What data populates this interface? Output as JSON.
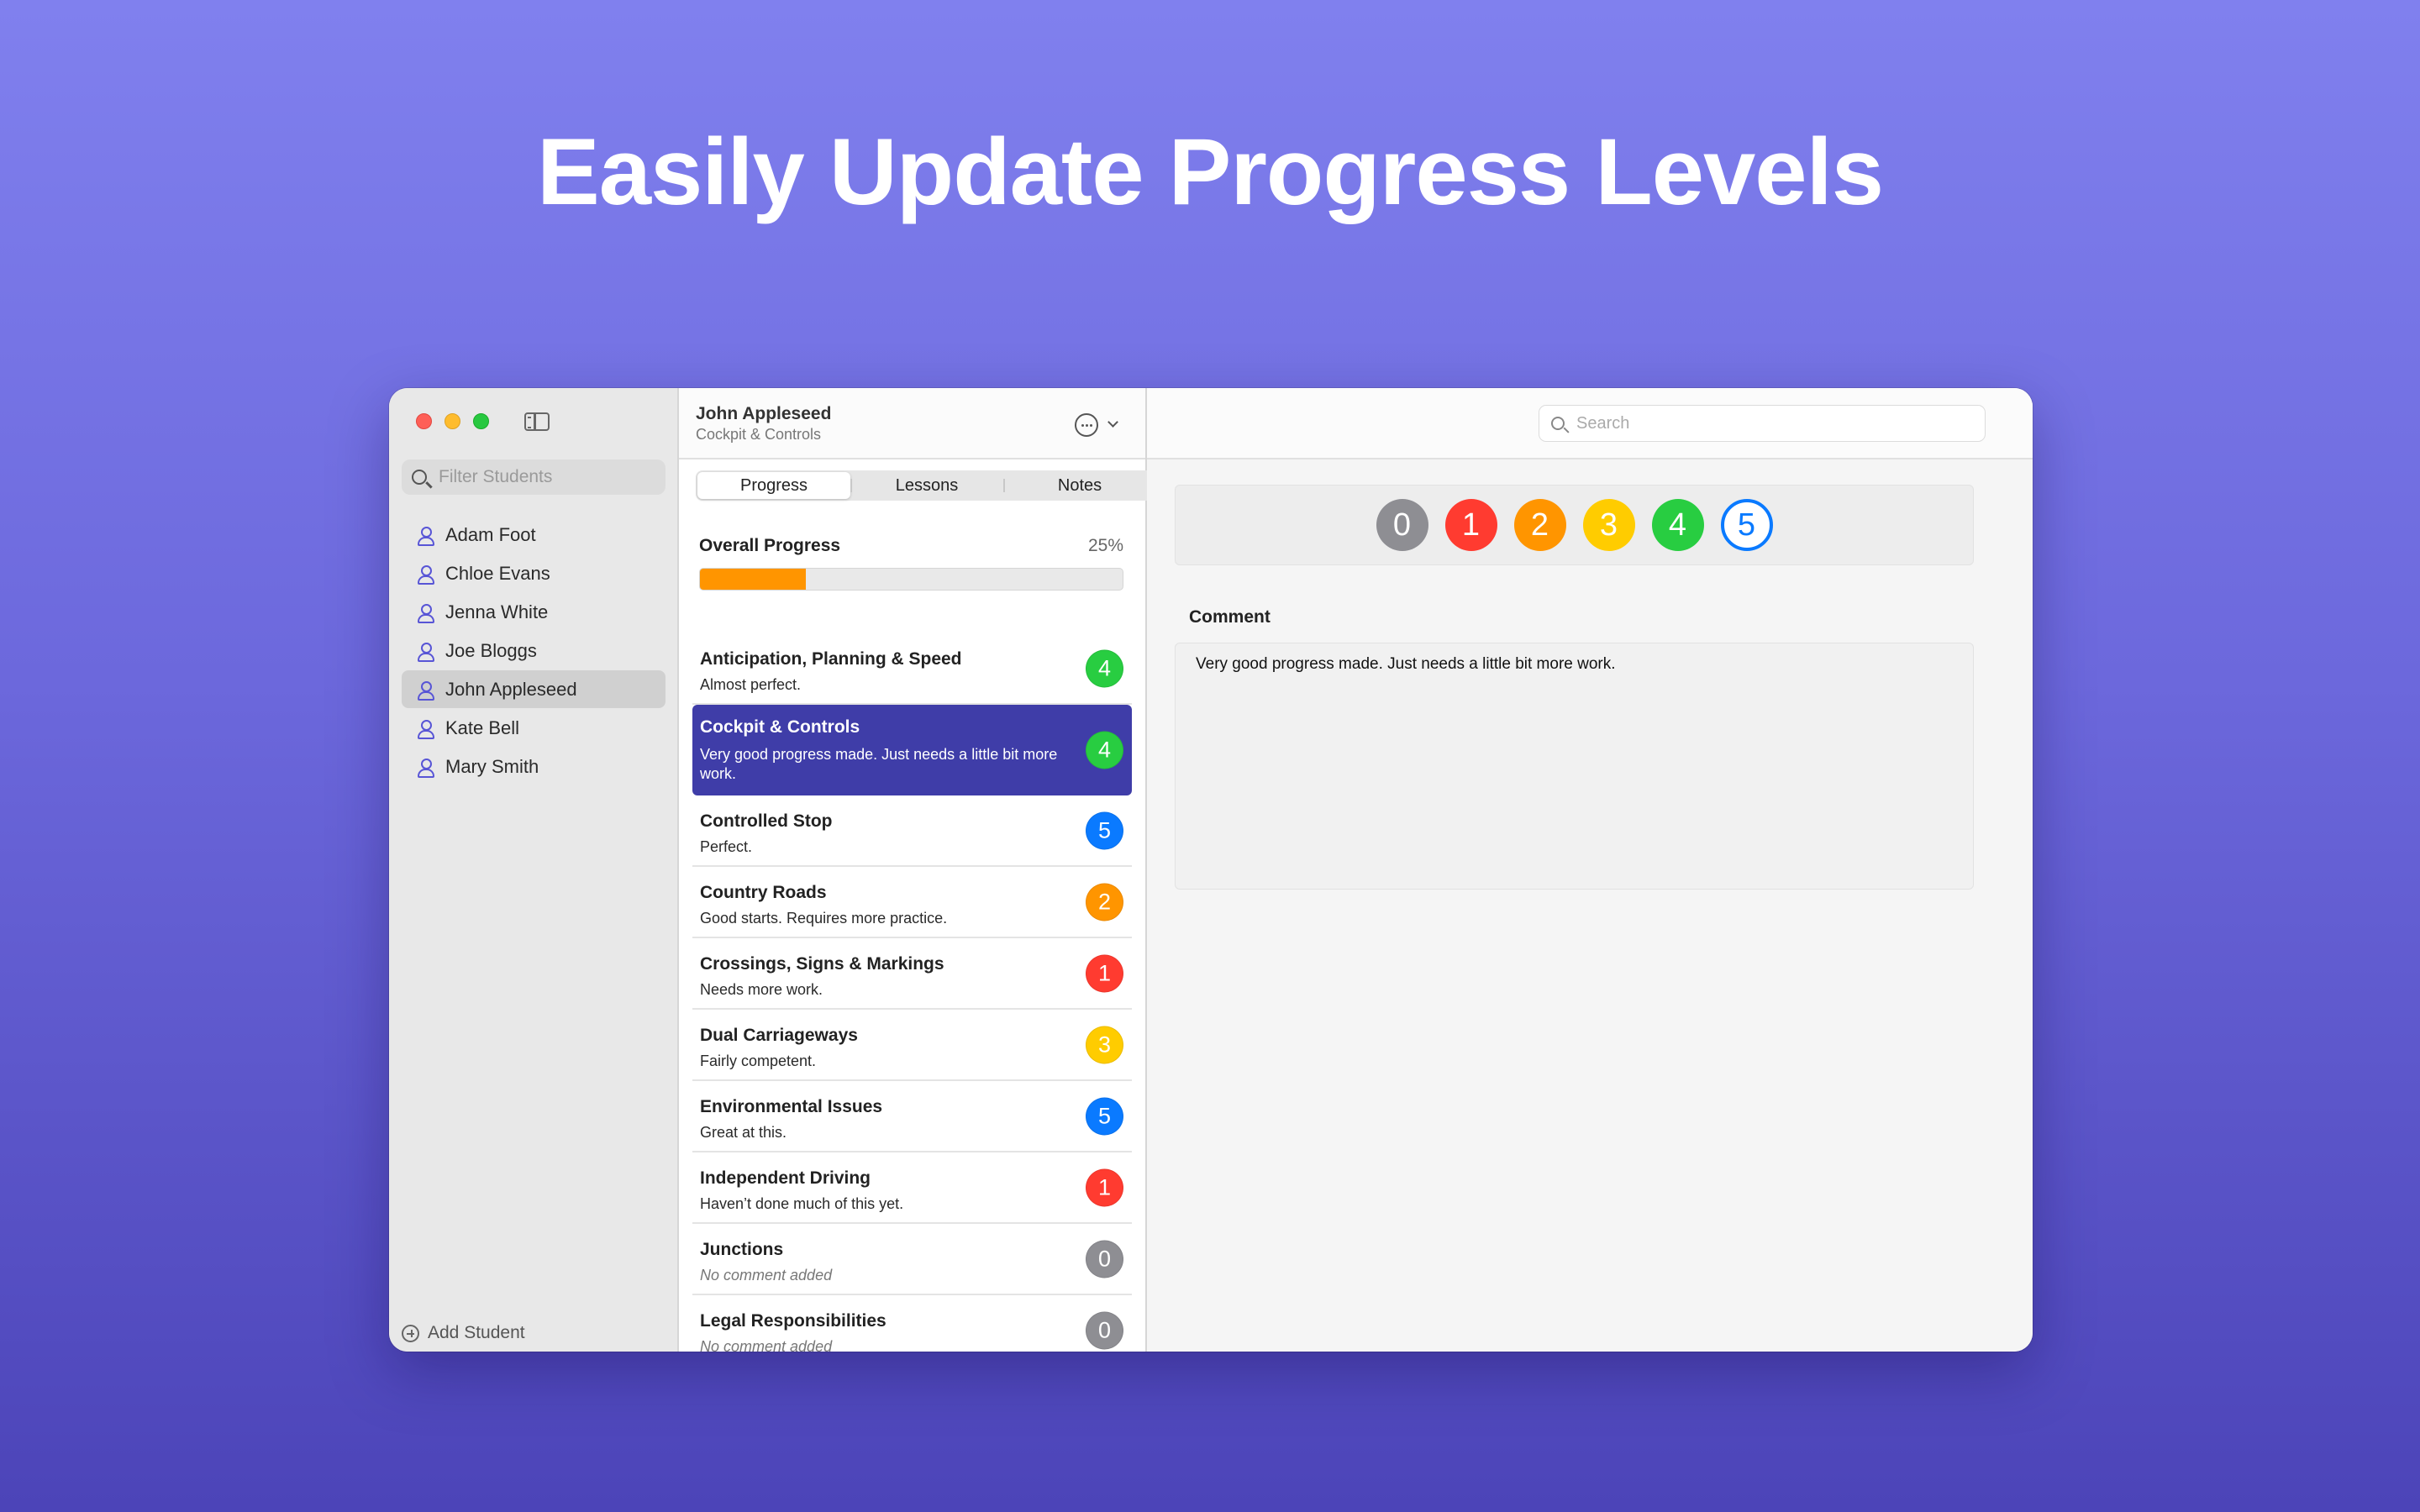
{
  "headline": "Easily Update Progress Levels",
  "sidebar": {
    "filter_placeholder": "Filter Students",
    "students": [
      "Adam Foot",
      "Chloe Evans",
      "Jenna White",
      "Joe Bloggs",
      "John Appleseed",
      "Kate Bell",
      "Mary Smith"
    ],
    "selected_student": "John Appleseed",
    "add_student_label": "Add Student"
  },
  "middle": {
    "title": "John Appleseed",
    "subtitle": "Cockpit & Controls",
    "tabs": [
      "Progress",
      "Lessons",
      "Notes"
    ],
    "active_tab": "Progress",
    "overall": {
      "label": "Overall Progress",
      "percent_label": "25%",
      "fraction": 0.25,
      "bar_color": "#ff9500"
    },
    "skills": [
      {
        "name": "Anticipation, Planning & Speed",
        "comment": "Almost perfect.",
        "level": "4",
        "selected": false
      },
      {
        "name": "Cockpit & Controls",
        "comment": "Very good progress made. Just needs a little bit more work.",
        "level": "4",
        "selected": true
      },
      {
        "name": "Controlled Stop",
        "comment": "Perfect.",
        "level": "5",
        "selected": false
      },
      {
        "name": "Country Roads",
        "comment": "Good starts. Requires more practice.",
        "level": "2",
        "selected": false
      },
      {
        "name": "Crossings, Signs & Markings",
        "comment": "Needs more work.",
        "level": "1",
        "selected": false
      },
      {
        "name": "Dual Carriageways",
        "comment": "Fairly competent.",
        "level": "3",
        "selected": false
      },
      {
        "name": "Environmental Issues",
        "comment": "Great at this.",
        "level": "5",
        "selected": false
      },
      {
        "name": "Independent Driving",
        "comment": "Haven’t done much of this yet.",
        "level": "1",
        "selected": false
      },
      {
        "name": "Junctions",
        "comment": "No comment added",
        "level": "0",
        "selected": false,
        "empty": true
      },
      {
        "name": "Legal Responsibilities",
        "comment": "No comment added",
        "level": "0",
        "selected": false,
        "empty": true
      }
    ]
  },
  "detail": {
    "search_placeholder": "Search",
    "levels": [
      "0",
      "1",
      "2",
      "3",
      "4",
      "5"
    ],
    "selected_level": "5",
    "comment_label": "Comment",
    "comment_text": "Very good progress made. Just needs a little bit more work."
  },
  "level_colors": {
    "0": "#8e8e93",
    "1": "#ff3b30",
    "2": "#ff9500",
    "3": "#ffcc00",
    "4": "#28cd41",
    "5": "#0a7aff"
  },
  "selection_color": "#3f3da8"
}
